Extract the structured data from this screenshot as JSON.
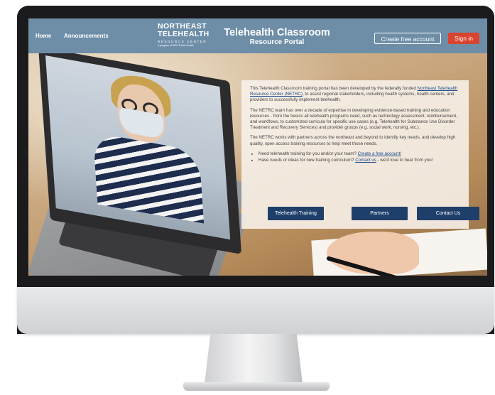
{
  "nav": {
    "home": "Home",
    "announcements": "Announcements"
  },
  "logo": {
    "line1": "NORTHEAST",
    "line2": "TELEHEALTH",
    "line3": "RESOURCE CENTER",
    "line4": "A program of MCD Public Health"
  },
  "portal": {
    "title": "Telehealth Classroom",
    "subtitle": "Resource Portal"
  },
  "header_buttons": {
    "create": "Create free account",
    "signin": "Sign in"
  },
  "panel": {
    "p1_start": "This Telehealth Classroom training portal has been developed by the federally funded",
    "p1_link": "Northeast Telehealth Resource Center (NETRC)",
    "p1_end": ", to assist regional stakeholders, including health systems, health centers, and providers to successfully implement telehealth.",
    "p2": "The NETRC team has over a decade of expertise in developing evidence-based training and education resources - from the basics all telehealth programs need, such as technology assessment, reimbursement, and workflows, to customized curricula for specific use cases (e.g. Telehealth for Substance Use Disorder Treatment and Recovery Services) and provider groups (e.g. social work, nursing, etc.).",
    "p3": "The NETRC works with partners across the northeast and beyond to identify key needs, and develop high quality, open access training resources to help meet those needs.",
    "bullet1_start": "Need telehealth training for you and/or your team? ",
    "bullet1_link": "Create a free account!",
    "bullet2_start": "Have needs or ideas for new training curriculum? ",
    "bullet2_link": "Contact us",
    "bullet2_end": " - we'd love to hear from you!",
    "buttons": {
      "training": "Telehealth Training",
      "partners": "Partners",
      "contact": "Contact Us"
    }
  },
  "colors": {
    "header_bg": "#6e8ea8",
    "signin_bg": "#d9432f",
    "panel_button_bg": "#1f3f6b",
    "link": "#1e4a8a"
  }
}
